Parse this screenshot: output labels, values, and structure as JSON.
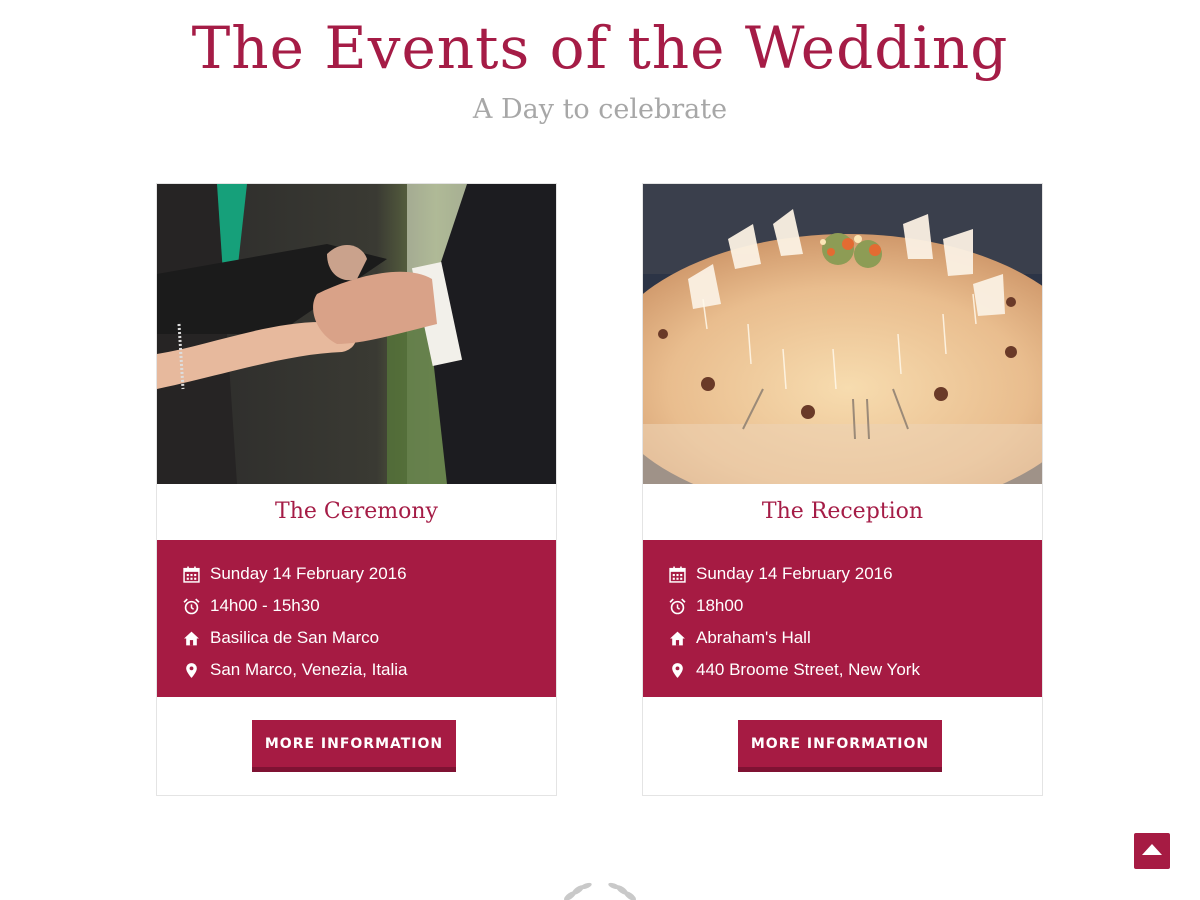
{
  "header": {
    "title": "The Events of the Wedding",
    "subtitle": "A Day to celebrate"
  },
  "events": [
    {
      "title": "The Ceremony",
      "date": "Sunday 14 February 2016",
      "time": "14h00 - 15h30",
      "venue": "Basilica de San Marco",
      "address": "San Marco, Venezia, Italia",
      "button_label": "MORE INFORMATION",
      "photo": "wedding ring exchange"
    },
    {
      "title": "The Reception",
      "date": "Sunday 14 February 2016",
      "time": "18h00",
      "venue": "Abraham's Hall",
      "address": "440 Broome Street, New York",
      "button_label": "MORE INFORMATION",
      "photo": "decorated round reception table"
    }
  ],
  "icons": {
    "date": "calendar-icon",
    "time": "alarm-clock-icon",
    "venue": "home-icon",
    "address": "map-pin-icon",
    "scroll_top": "caret-up-icon",
    "divider": "laurel-icon"
  },
  "colors": {
    "accent": "#a61b43",
    "accent_dark": "#7f1233",
    "title": "#a51c46",
    "subtitle": "#a7a7a7"
  }
}
